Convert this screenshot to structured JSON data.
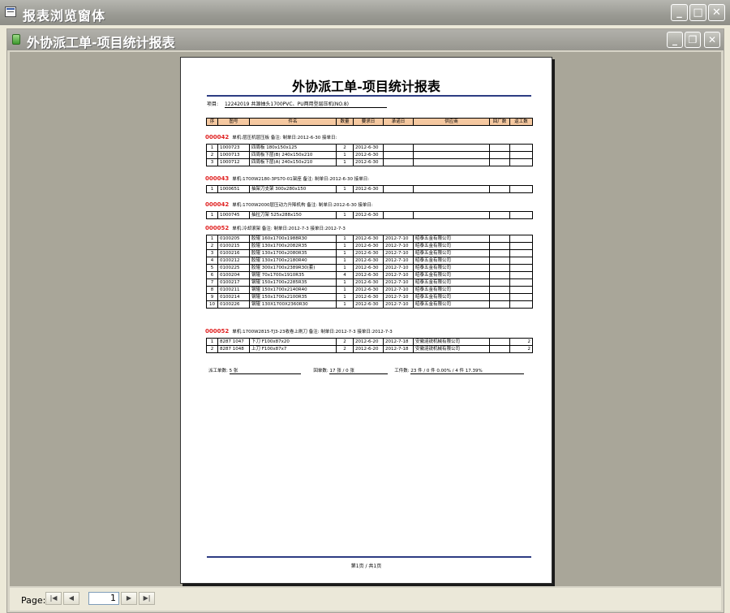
{
  "app": {
    "title": "报表浏览窗体"
  },
  "doc": {
    "title": "外协派工单-项目统计报表"
  },
  "report": {
    "title": "外协派工单-项目统计报表",
    "project_label": "项目:",
    "project_value": "12242019 共源抽头1700PVC、PU两用型层压机(NO.8)",
    "headers": [
      "序",
      "图号",
      "件名",
      "数量",
      "要求日",
      "承诺日",
      "供应商",
      "回厂数",
      "返工数"
    ],
    "groups": [
      {
        "no": "000042",
        "info": "单机:层压机层压板   备注:   制单日:2012-6-30   接单日:",
        "rows": [
          [
            "1",
            "1000723",
            "四周板 180x150x125",
            "2",
            "2012-6-30",
            "",
            "",
            "",
            ""
          ],
          [
            "2",
            "1000713",
            "四周板下层(B) 240x150x210",
            "1",
            "2012-6-30",
            "",
            "",
            "",
            ""
          ],
          [
            "3",
            "1000712",
            "四周板下层(A) 240x150x210",
            "1",
            "2012-6-30",
            "",
            "",
            "",
            ""
          ]
        ]
      },
      {
        "no": "000043",
        "info": "单机:1700W2180-3PS70-01架座   备注:   制单日:2012-6-30   接单日:",
        "rows": [
          [
            "1",
            "1000651",
            "抽架刀支架 300x280x150",
            "1",
            "2012-6-30",
            "",
            "",
            "",
            ""
          ]
        ]
      },
      {
        "no": "000042",
        "info": "单机:1700W2000层压动力升降机构   备注:   制单日:2012-6-30   接单日:",
        "rows": [
          [
            "1",
            "1000745",
            "抽拉刀架 525x288x150",
            "1",
            "2012-6-30",
            "",
            "",
            "",
            ""
          ]
        ]
      },
      {
        "no": "000052",
        "info": "单机:冷却滚架   备注:   制单日:2012-7-3   接单日:2012-7-3",
        "rows": [
          [
            "1",
            "0100205",
            "胶辊 160x1700x1988R30",
            "1",
            "2012-6-30",
            "2012-7-10",
            "昭泰五金有限公司",
            "",
            ""
          ],
          [
            "2",
            "0100215",
            "胶辊 130x1700x2082R35",
            "1",
            "2012-6-30",
            "2012-7-10",
            "昭泰五金有限公司",
            "",
            ""
          ],
          [
            "3",
            "0100216",
            "胶辊 130x1700x2080R35",
            "1",
            "2012-6-30",
            "2012-7-10",
            "昭泰五金有限公司",
            "",
            ""
          ],
          [
            "4",
            "0100212",
            "胶辊 130x1700x2180R40",
            "1",
            "2012-6-30",
            "2012-7-10",
            "昭泰五金有限公司",
            "",
            ""
          ],
          [
            "5",
            "0100225",
            "胶辊 300x1700x2389R30(套)",
            "1",
            "2012-6-30",
            "2012-7-10",
            "昭泰五金有限公司",
            "",
            ""
          ],
          [
            "6",
            "0100204",
            "钢辊 70x1700x1910R35",
            "4",
            "2012-6-30",
            "2012-7-10",
            "昭泰五金有限公司",
            "",
            ""
          ],
          [
            "7",
            "0100217",
            "钢辊 150x1700x2285R35",
            "1",
            "2012-6-30",
            "2012-7-10",
            "昭泰五金有限公司",
            "",
            ""
          ],
          [
            "8",
            "0100211",
            "钢辊 150x1700x2140R40",
            "1",
            "2012-6-30",
            "2012-7-10",
            "昭泰五金有限公司",
            "",
            ""
          ],
          [
            "9",
            "0100214",
            "钢辊 150x1700x2100R35",
            "1",
            "2012-6-30",
            "2012-7-10",
            "昭泰五金有限公司",
            "",
            ""
          ],
          [
            "10",
            "0100226",
            "钢辊 130X1700X2360R30",
            "1",
            "2012-6-30",
            "2012-7-10",
            "昭泰五金有限公司",
            "",
            ""
          ]
        ]
      },
      {
        "no": "000052",
        "info": "单机:1700W2815-TJ3-23收卷上刷刀   备注:   制单日:2012-7-3   接单日:2012-7-3",
        "rows": [
          [
            "1",
            "8287 1047",
            "下刀 F100x87x20",
            "2",
            "2012-6-20",
            "2012-7-18",
            "安徽涟锐机械有限公司",
            "",
            "2"
          ],
          [
            "2",
            "8287 1048",
            "上刀 F100x87x7",
            "2",
            "2012-6-20",
            "2012-7-18",
            "安徽涟锐机械有限公司",
            "",
            "2"
          ]
        ]
      }
    ],
    "summary": {
      "label1": "派工单数:",
      "value1": "5 张",
      "label2": "回单数:",
      "value2": "17 张 / 0 张",
      "label3": "工件数:",
      "value3": "23 件 / 0 件 0.00% / 4 件 17.39%"
    },
    "page_no": "第1页 / 共1页"
  },
  "status": {
    "page_label": "Page:",
    "page_value": "1"
  }
}
